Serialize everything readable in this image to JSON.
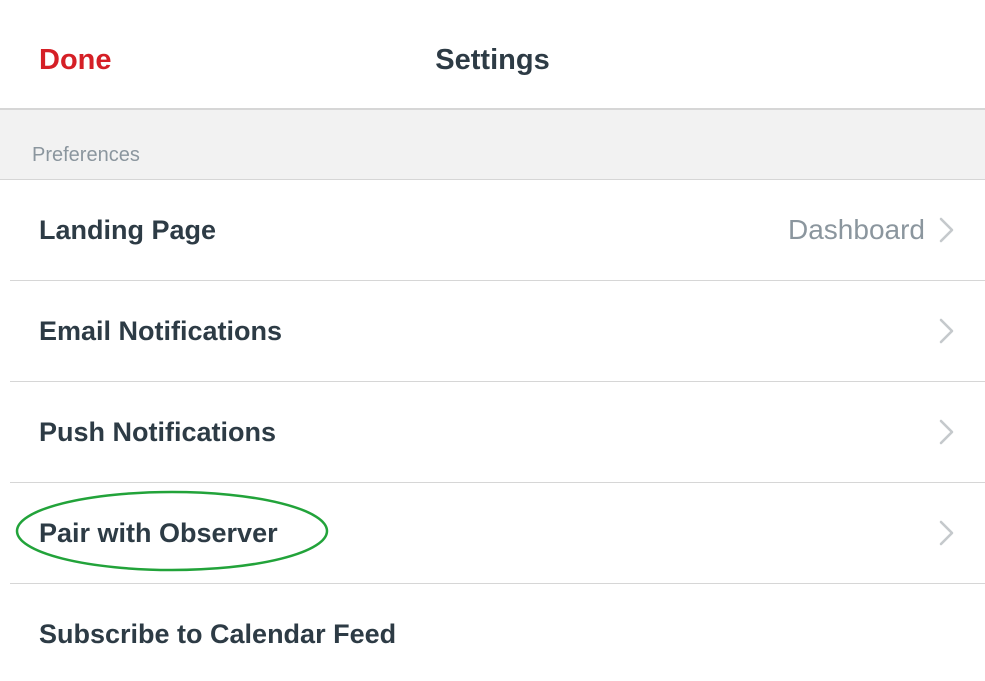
{
  "nav": {
    "done_label": "Done",
    "title": "Settings"
  },
  "section": {
    "header": "Preferences"
  },
  "rows": [
    {
      "label": "Landing Page",
      "value": "Dashboard"
    },
    {
      "label": "Email Notifications",
      "value": ""
    },
    {
      "label": "Push Notifications",
      "value": ""
    },
    {
      "label": "Pair with Observer",
      "value": ""
    },
    {
      "label": "Subscribe to Calendar Feed",
      "value": ""
    }
  ],
  "icons": {
    "chevron": "chevron-right-icon"
  },
  "colors": {
    "accent": "#d51f26",
    "text": "#2d3b45",
    "secondary_text": "#8b969e",
    "section_bg": "#f2f2f2",
    "divider": "#d6d6d6",
    "chevron": "#c5c9cc",
    "annotation": "#22a33a"
  }
}
